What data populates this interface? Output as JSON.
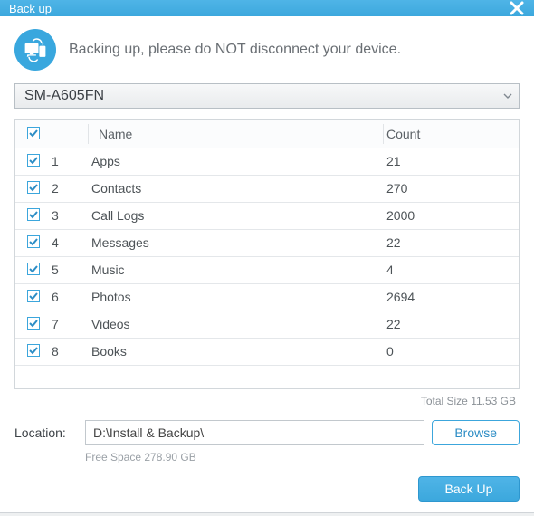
{
  "title": "Back up",
  "status_text": "Backing up, please do NOT disconnect your device.",
  "device": {
    "selected": "SM-A605FN"
  },
  "table": {
    "headers": {
      "name": "Name",
      "count": "Count"
    },
    "rows": [
      {
        "idx": "1",
        "name": "Apps",
        "count": "21",
        "checked": true
      },
      {
        "idx": "2",
        "name": "Contacts",
        "count": "270",
        "checked": true
      },
      {
        "idx": "3",
        "name": "Call Logs",
        "count": "2000",
        "checked": true
      },
      {
        "idx": "4",
        "name": "Messages",
        "count": "22",
        "checked": true
      },
      {
        "idx": "5",
        "name": "Music",
        "count": "4",
        "checked": true
      },
      {
        "idx": "6",
        "name": "Photos",
        "count": "2694",
        "checked": true
      },
      {
        "idx": "7",
        "name": "Videos",
        "count": "22",
        "checked": true
      },
      {
        "idx": "8",
        "name": "Books",
        "count": "0",
        "checked": true
      }
    ]
  },
  "total_size": "Total Size 11.53 GB",
  "location": {
    "label": "Location:",
    "path": "D:\\Install & Backup\\",
    "free_space": "Free Space 278.90 GB"
  },
  "buttons": {
    "browse": "Browse",
    "backup": "Back Up"
  }
}
